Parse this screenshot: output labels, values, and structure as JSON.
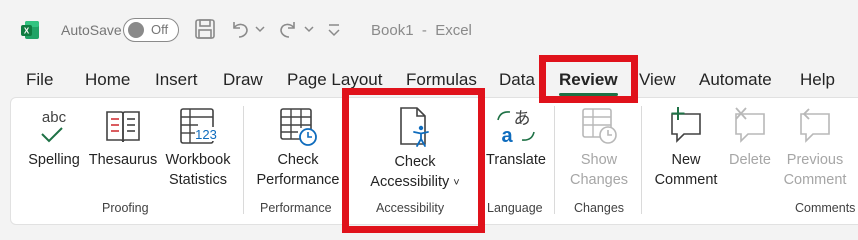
{
  "titlebar": {
    "app_icon": "excel-logo-icon",
    "autosave_label": "AutoSave",
    "autosave_state": "Off",
    "document_title": "Book1  -  Excel"
  },
  "tabs": [
    "File",
    "Home",
    "Insert",
    "Draw",
    "Page Layout",
    "Formulas",
    "Data",
    "Review",
    "View",
    "Automate",
    "Help"
  ],
  "active_tab": "Review",
  "ribbon": {
    "proofing": {
      "group_label": "Proofing",
      "spelling": {
        "icon_text": "abc",
        "label": "Spelling"
      },
      "thesaurus": {
        "label": "Thesaurus"
      },
      "workbook_statistics": {
        "line1": "Workbook",
        "line2": "Statistics",
        "icon_text": "123"
      }
    },
    "performance": {
      "group_label": "Performance",
      "check_performance": {
        "line1": "Check",
        "line2": "Performance"
      }
    },
    "accessibility": {
      "group_label": "Accessibility",
      "check_accessibility": {
        "line1": "Check",
        "line2": "Accessibility",
        "caret": "˅"
      }
    },
    "language": {
      "group_label": "Language",
      "translate": {
        "label": "Translate",
        "icon_text_top": "あ",
        "icon_text_bottom": "a"
      }
    },
    "changes": {
      "group_label": "Changes",
      "show_changes": {
        "line1": "Show",
        "line2": "Changes",
        "disabled": true
      }
    },
    "comments": {
      "group_label": "Comments",
      "new_comment": {
        "line1": "New",
        "line2": "Comment"
      },
      "delete": {
        "label": "Delete",
        "disabled": true
      },
      "previous_comment": {
        "line1": "Previous",
        "line2": "Comment",
        "disabled": true
      }
    }
  },
  "colors": {
    "accent": "#1e7145",
    "highlight": "#e0121b",
    "disabled": "#a6a6a6"
  }
}
